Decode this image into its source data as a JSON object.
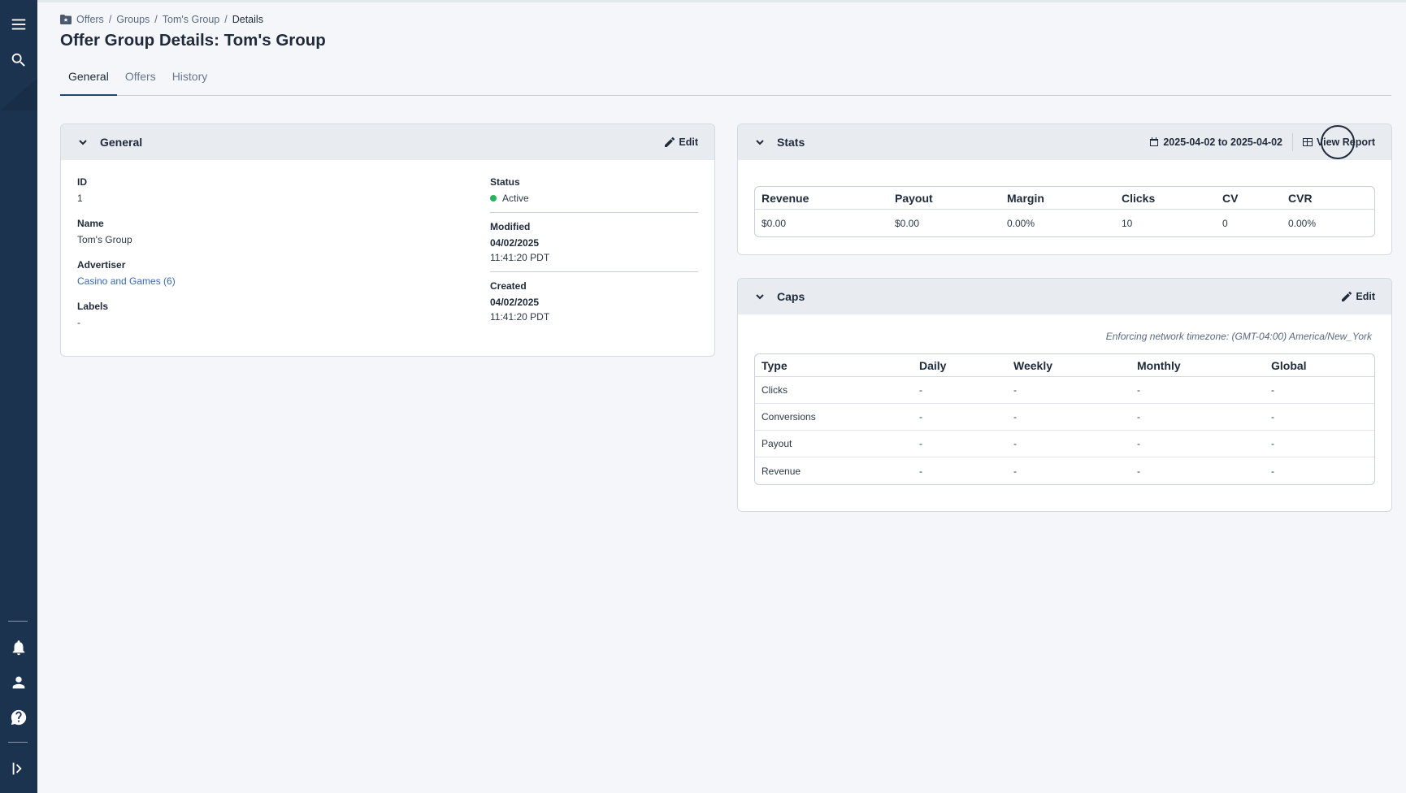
{
  "sidebar": {
    "icons": [
      "menu-icon",
      "search-icon",
      "bell-icon",
      "user-icon",
      "help-icon",
      "expand-sidebar-icon"
    ]
  },
  "breadcrumb": {
    "items": [
      "Offers",
      "Groups",
      "Tom's Group"
    ],
    "current": "Details"
  },
  "page": {
    "title": "Offer Group Details: Tom's Group"
  },
  "tabs": [
    {
      "label": "General",
      "active": true
    },
    {
      "label": "Offers",
      "active": false
    },
    {
      "label": "History",
      "active": false
    }
  ],
  "general_card": {
    "title": "General",
    "edit_label": "Edit",
    "fields_left": [
      {
        "label": "ID",
        "value": "1"
      },
      {
        "label": "Name",
        "value": "Tom's Group"
      },
      {
        "label": "Advertiser",
        "value": "Casino and Games (6)"
      },
      {
        "label": "Labels",
        "value": "-"
      }
    ],
    "status": {
      "label": "Status",
      "value": "Active",
      "color": "#27b35a"
    },
    "modified": {
      "label": "Modified",
      "date": "04/02/2025",
      "time": "11:41:20 PDT"
    },
    "created": {
      "label": "Created",
      "date": "04/02/2025",
      "time": "11:41:20 PDT"
    }
  },
  "stats_card": {
    "title": "Stats",
    "date_range": "2025-04-02 to 2025-04-02",
    "view_report_label": "View Report",
    "headers": [
      "Revenue",
      "Payout",
      "Margin",
      "Clicks",
      "CV",
      "CVR"
    ],
    "row": [
      "$0.00",
      "$0.00",
      "0.00%",
      "10",
      "0",
      "0.00%"
    ]
  },
  "caps_card": {
    "title": "Caps",
    "edit_label": "Edit",
    "timezone_note": "Enforcing network timezone: (GMT-04:00) America/New_York",
    "headers": [
      "Type",
      "Daily",
      "Weekly",
      "Monthly",
      "Global"
    ],
    "rows": [
      [
        "Clicks",
        "-",
        "-",
        "-",
        "-"
      ],
      [
        "Conversions",
        "-",
        "-",
        "-",
        "-"
      ],
      [
        "Payout",
        "-",
        "-",
        "-",
        "-"
      ],
      [
        "Revenue",
        "-",
        "-",
        "-",
        "-"
      ]
    ]
  }
}
